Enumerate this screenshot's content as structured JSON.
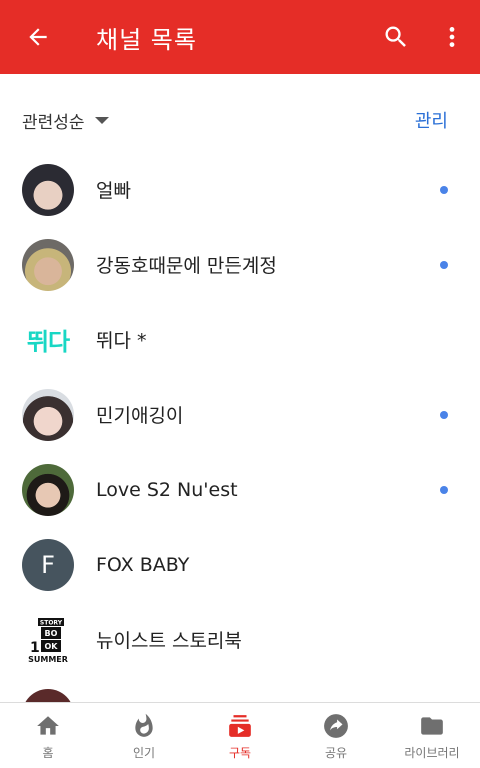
{
  "appbar": {
    "title": "채널 목록",
    "back_icon": "arrow-back-icon",
    "search_icon": "search-icon",
    "more_icon": "more-vert-icon",
    "color": "#e52d27"
  },
  "sort": {
    "label": "관련성순",
    "manage_label": "관리"
  },
  "channels": [
    {
      "name": "얼빠",
      "avatar": "photo",
      "new_dot": true
    },
    {
      "name": "강동호때문에 만든계정",
      "avatar": "photo",
      "new_dot": true
    },
    {
      "name": "뛰다 *",
      "avatar": "text",
      "avatar_text": "뛰다",
      "new_dot": false
    },
    {
      "name": "민기애깅이",
      "avatar": "photo",
      "new_dot": true
    },
    {
      "name": "Love S2 Nu'est",
      "avatar": "photo",
      "new_dot": true
    },
    {
      "name": "FOX BABY",
      "avatar": "letter",
      "avatar_letter": "F",
      "new_dot": false
    },
    {
      "name": "뉴이스트 스토리북",
      "avatar": "logo",
      "logo_text": [
        "STORY",
        "BO",
        "OK",
        "1",
        "SUMMER"
      ],
      "new_dot": false
    }
  ],
  "bottom_nav": [
    {
      "label": "홈",
      "icon": "home-icon",
      "active": false
    },
    {
      "label": "인기",
      "icon": "fire-icon",
      "active": false
    },
    {
      "label": "구독",
      "icon": "subscriptions-icon",
      "active": true
    },
    {
      "label": "공유",
      "icon": "share-icon",
      "active": false
    },
    {
      "label": "라이브러리",
      "icon": "folder-icon",
      "active": false
    }
  ],
  "colors": {
    "accent": "#e52d27",
    "link_blue": "#2a6fd6",
    "dot_blue": "#4a83e8",
    "inactive_icon": "#6f6f6f"
  }
}
